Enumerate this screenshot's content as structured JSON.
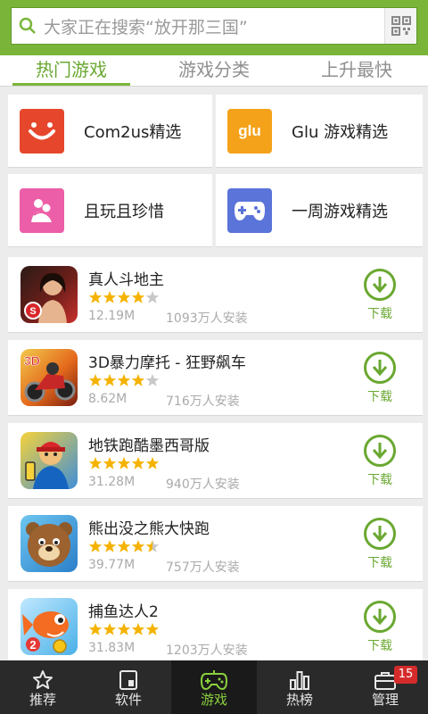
{
  "search": {
    "placeholder": "大家正在搜索“放开那三国”"
  },
  "tabs": [
    {
      "label": "热门游戏",
      "active": true
    },
    {
      "label": "游戏分类",
      "active": false
    },
    {
      "label": "上升最快",
      "active": false
    }
  ],
  "categories": [
    {
      "label": "Com2us精选",
      "icon": "com2us-smile-icon",
      "color": "#e6472c"
    },
    {
      "label": "Glu 游戏精选",
      "icon": "glu-logo-icon",
      "color": "#f4a21a"
    },
    {
      "label": "且玩且珍惜",
      "icon": "hug-icon",
      "color": "#ec5ea7"
    },
    {
      "label": "一周游戏精选",
      "icon": "gamepad-icon",
      "color": "#5b74d9"
    }
  ],
  "apps": [
    {
      "name": "真人斗地主",
      "rating": 4,
      "size": "12.19M",
      "installs": "1093万人安装",
      "download": "下载"
    },
    {
      "name": "3D暴力摩托 - 狂野飙车",
      "rating": 4,
      "size": "8.62M",
      "installs": "716万人安装",
      "download": "下载"
    },
    {
      "name": "地铁跑酷墨西哥版",
      "rating": 5,
      "size": "31.28M",
      "installs": "940万人安装",
      "download": "下载"
    },
    {
      "name": "熊出没之熊大快跑",
      "rating": 4.5,
      "size": "39.77M",
      "installs": "757万人安装",
      "download": "下载"
    },
    {
      "name": "捕鱼达人2",
      "rating": 5,
      "size": "31.83M",
      "installs": "1203万人安装",
      "download": "下载"
    }
  ],
  "bottom_nav": [
    {
      "label": "推荐",
      "icon": "star-icon",
      "active": false
    },
    {
      "label": "软件",
      "icon": "app-icon",
      "active": false
    },
    {
      "label": "游戏",
      "icon": "gamepad-icon",
      "active": true
    },
    {
      "label": "热榜",
      "icon": "bar-chart-icon",
      "active": false
    },
    {
      "label": "管理",
      "icon": "briefcase-icon",
      "active": false
    }
  ],
  "manage_badge": "15",
  "colors": {
    "accent": "#7ab53a",
    "star": "#f5b301",
    "badge": "#d52b2b"
  }
}
